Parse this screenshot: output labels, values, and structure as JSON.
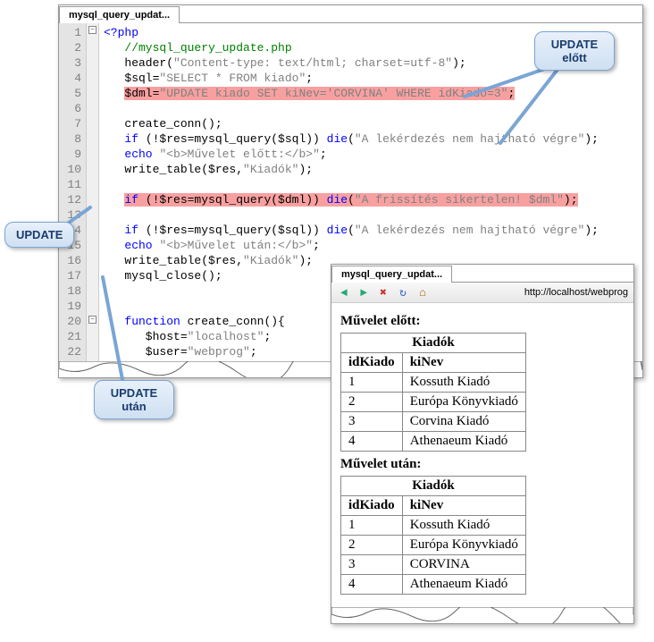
{
  "editor": {
    "tab_title": "mysql_query_updat...",
    "lines": [
      {
        "n": "1",
        "html": "<span class='tok-tag'>&lt;?php</span>"
      },
      {
        "n": "2",
        "html": "   <span class='tok-comment'>//mysql_query_update.php</span>"
      },
      {
        "n": "3",
        "html": "   header(<span class='tok-str'>\"Content-type: text/html; charset=utf-8\"</span>);"
      },
      {
        "n": "4",
        "html": "   $sql=<span class='tok-str'>\"SELECT * FROM kiado\"</span>;"
      },
      {
        "n": "5",
        "html": "   <span class='hl'>$dml=<span class='tok-str'>\"UPDATE kiado SET kiNev='CORVINA' WHERE idKiado=3\"</span>;</span>"
      },
      {
        "n": "6",
        "html": " "
      },
      {
        "n": "7",
        "html": "   create_conn();"
      },
      {
        "n": "8",
        "html": "   <span class='tok-kw'>if</span> (!$res=mysql_query($sql)) <span class='tok-kw'>die</span>(<span class='tok-str'>\"A lekérdezés nem hajtható végre\"</span>);"
      },
      {
        "n": "9",
        "html": "   <span class='tok-kw'>echo</span> <span class='tok-str'>\"&lt;b&gt;Művelet előtt:&lt;/b&gt;\"</span>;"
      },
      {
        "n": "10",
        "html": "   write_table($res,<span class='tok-str'>\"Kiadók\"</span>);"
      },
      {
        "n": "11",
        "html": " "
      },
      {
        "n": "12",
        "html": "   <span class='hl'><span class='tok-kw'>if</span> (!$res=mysql_query($dml)) <span class='tok-kw'>die</span>(<span class='tok-str'>\"A frissítés sikertelen! $dml\"</span>);</span>"
      },
      {
        "n": "13",
        "html": " "
      },
      {
        "n": "14",
        "html": "   <span class='tok-kw'>if</span> (!$res=mysql_query($sql)) <span class='tok-kw'>die</span>(<span class='tok-str'>\"A lekérdezés nem hajtható végre\"</span>);"
      },
      {
        "n": "15",
        "html": "   <span class='tok-kw'>echo</span> <span class='tok-str'>\"&lt;b&gt;Művelet után:&lt;/b&gt;\"</span>;"
      },
      {
        "n": "16",
        "html": "   write_table($res,<span class='tok-str'>\"Kiadók\"</span>);"
      },
      {
        "n": "17",
        "html": "   mysql_close();"
      },
      {
        "n": "18",
        "html": " "
      },
      {
        "n": "19",
        "html": " "
      },
      {
        "n": "20",
        "html": "   <span class='tok-kw'>function</span> create_conn(){"
      },
      {
        "n": "21",
        "html": "      $host=<span class='tok-str'>\"localhost\"</span>;"
      },
      {
        "n": "22",
        "html": "      $user=<span class='tok-str'>\"webprog\"</span>;"
      }
    ]
  },
  "callouts": {
    "before": {
      "l1": "UPDATE",
      "l2": "előtt"
    },
    "update": {
      "l1": "UPDATE"
    },
    "after": {
      "l1": "UPDATE",
      "l2": "után"
    }
  },
  "browser": {
    "tab_title": "mysql_query_updat...",
    "url": "http://localhost/webprog",
    "section_before": "Művelet előtt:",
    "section_after": "Művelet után:",
    "table_caption": "Kiadók",
    "col_id": "idKiado",
    "col_name": "kiNev",
    "rows_before": [
      {
        "id": "1",
        "name": "Kossuth Kiadó"
      },
      {
        "id": "2",
        "name": "Európa Könyvkiadó"
      },
      {
        "id": "3",
        "name": "Corvina Kiadó"
      },
      {
        "id": "4",
        "name": "Athenaeum Kiadó"
      }
    ],
    "rows_after": [
      {
        "id": "1",
        "name": "Kossuth Kiadó"
      },
      {
        "id": "2",
        "name": "Európa Könyvkiadó"
      },
      {
        "id": "3",
        "name": "CORVINA"
      },
      {
        "id": "4",
        "name": "Athenaeum Kiadó"
      }
    ]
  }
}
